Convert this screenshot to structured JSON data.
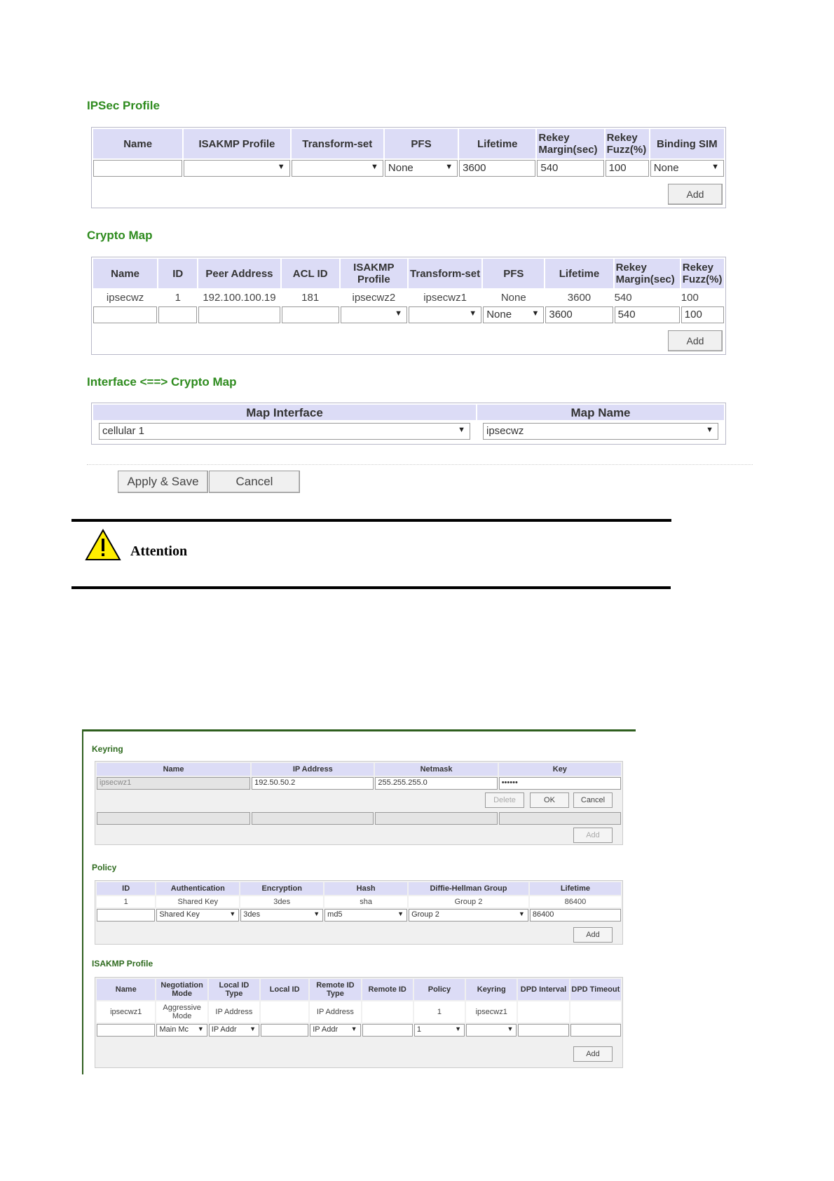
{
  "ipsec_profile": {
    "title": "IPSec Profile",
    "headers": [
      "Name",
      "ISAKMP Profile",
      "Transform-set",
      "PFS",
      "Lifetime",
      "Rekey Margin(sec)",
      "Rekey Fuzz(%)",
      "Binding SIM"
    ],
    "new_row": {
      "name": "",
      "isakmp_profile": "",
      "transform_set": "",
      "pfs": "None",
      "lifetime": "3600",
      "rekey_margin": "540",
      "rekey_fuzz": "100",
      "binding_sim": "None"
    },
    "add_label": "Add"
  },
  "crypto_map": {
    "title": "Crypto Map",
    "headers": [
      "Name",
      "ID",
      "Peer Address",
      "ACL ID",
      "ISAKMP Profile",
      "Transform-set",
      "PFS",
      "Lifetime",
      "Rekey Margin(sec)",
      "Rekey Fuzz(%)"
    ],
    "rows": [
      {
        "name": "ipsecwz",
        "id": "1",
        "peer": "192.100.100.19",
        "acl": "181",
        "isakmp": "ipsecwz2",
        "transform": "ipsecwz1",
        "pfs": "None",
        "lifetime": "3600",
        "margin": "540",
        "fuzz": "100"
      }
    ],
    "new_row": {
      "pfs": "None",
      "lifetime": "3600",
      "margin": "540",
      "fuzz": "100"
    },
    "add_label": "Add"
  },
  "iface_map": {
    "title": "Interface <==> Crypto Map",
    "headers": [
      "Map Interface",
      "Map Name"
    ],
    "interface_value": "cellular 1",
    "map_name_value": "ipsecwz"
  },
  "actions": {
    "apply_label": "Apply & Save",
    "cancel_label": "Cancel"
  },
  "attention": {
    "label": "Attention",
    "icon": "warning-triangle-icon"
  },
  "keyring": {
    "title": "Keyring",
    "headers": [
      "Name",
      "IP Address",
      "Netmask",
      "Key"
    ],
    "edit_row": {
      "name": "ipsecwz1",
      "ip": "192.50.50.2",
      "netmask": "255.255.255.0",
      "key": "••••••"
    },
    "delete_label": "Delete",
    "ok_label": "OK",
    "cancel_label": "Cancel",
    "add_label": "Add"
  },
  "policy": {
    "title": "Policy",
    "headers": [
      "ID",
      "Authentication",
      "Encryption",
      "Hash",
      "Diffie-Hellman Group",
      "Lifetime"
    ],
    "rows": [
      {
        "id": "1",
        "auth": "Shared Key",
        "enc": "3des",
        "hash": "sha",
        "dh": "Group 2",
        "lifetime": "86400"
      }
    ],
    "new_row": {
      "auth": "Shared Key",
      "enc": "3des",
      "hash": "md5",
      "dh": "Group 2",
      "lifetime": "86400"
    },
    "add_label": "Add"
  },
  "isakmp_profile": {
    "title": "ISAKMP Profile",
    "headers": [
      "Name",
      "Negotiation Mode",
      "Local ID Type",
      "Local ID",
      "Remote ID Type",
      "Remote ID",
      "Policy",
      "Keyring",
      "DPD Interval",
      "DPD Timeout"
    ],
    "rows": [
      {
        "name": "ipsecwz1",
        "mode": "Aggressive Mode",
        "local_type": "IP Address",
        "local_id": "",
        "remote_type": "IP Address",
        "remote_id": "",
        "policy": "1",
        "keyring": "ipsecwz1",
        "dpd_interval": "",
        "dpd_timeout": ""
      }
    ],
    "new_row": {
      "mode": "Main Mc",
      "local_type": "IP Addr",
      "remote_type": "IP Addr",
      "policy": "1"
    },
    "add_label": "Add"
  }
}
